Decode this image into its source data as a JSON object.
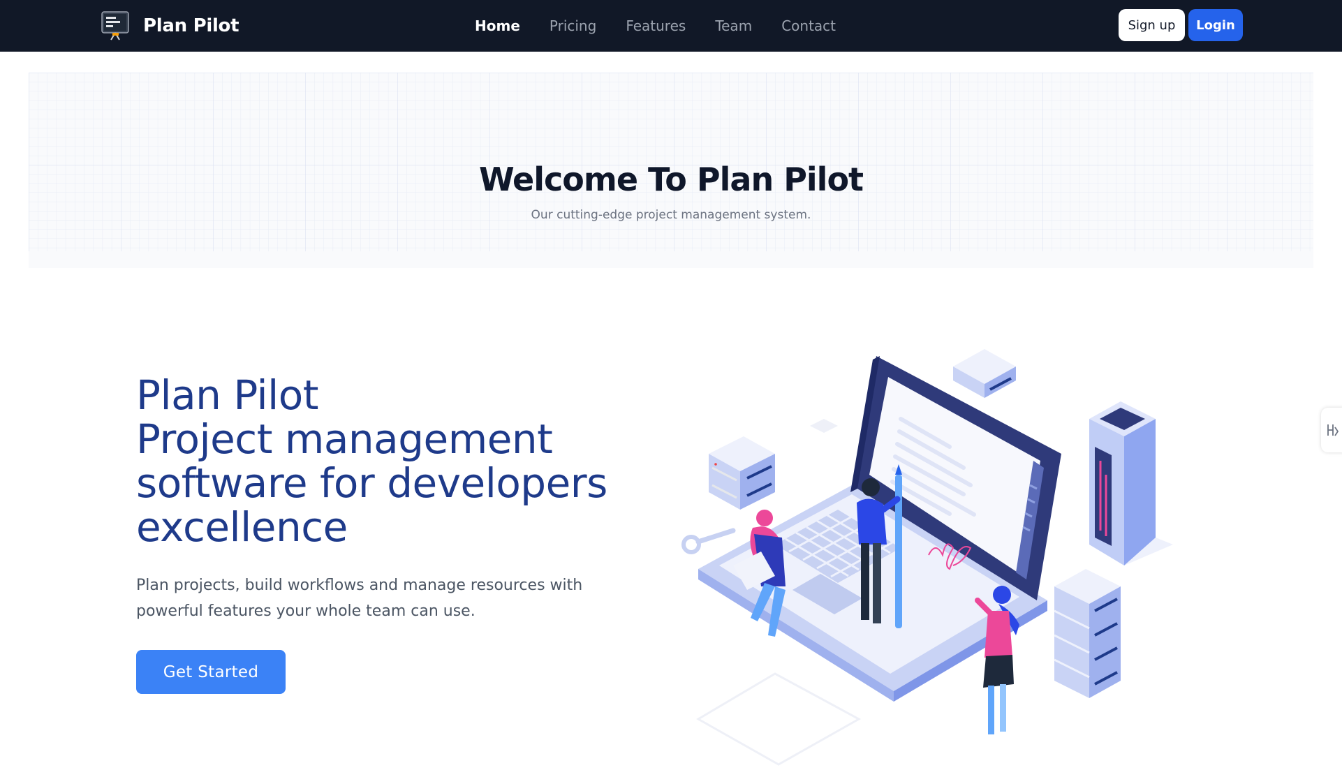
{
  "brand": {
    "name": "Plan Pilot",
    "logo_icon": "presentation-board-icon"
  },
  "nav": {
    "links": [
      {
        "label": "Home",
        "active": true
      },
      {
        "label": "Pricing",
        "active": false
      },
      {
        "label": "Features",
        "active": false
      },
      {
        "label": "Team",
        "active": false
      },
      {
        "label": "Contact",
        "active": false
      }
    ],
    "signup_label": "Sign up",
    "login_label": "Login"
  },
  "banner": {
    "title": "Welcome To Plan Pilot",
    "subtitle": "Our cutting-edge project management system."
  },
  "hero": {
    "headline_lines": [
      "Plan Pilot",
      "Project management",
      "software for developers",
      "excellence"
    ],
    "description": "Plan projects, build workflows and manage resources with powerful features your whole team can use.",
    "cta_label": "Get Started",
    "illustration_icon": "isometric-laptop-team-illustration"
  },
  "side_tab": {
    "icon": "translate-icon"
  },
  "colors": {
    "navbar_bg": "#111827",
    "primary": "#2563eb",
    "cta": "#3b82f6",
    "headline": "#1e3a8a"
  }
}
